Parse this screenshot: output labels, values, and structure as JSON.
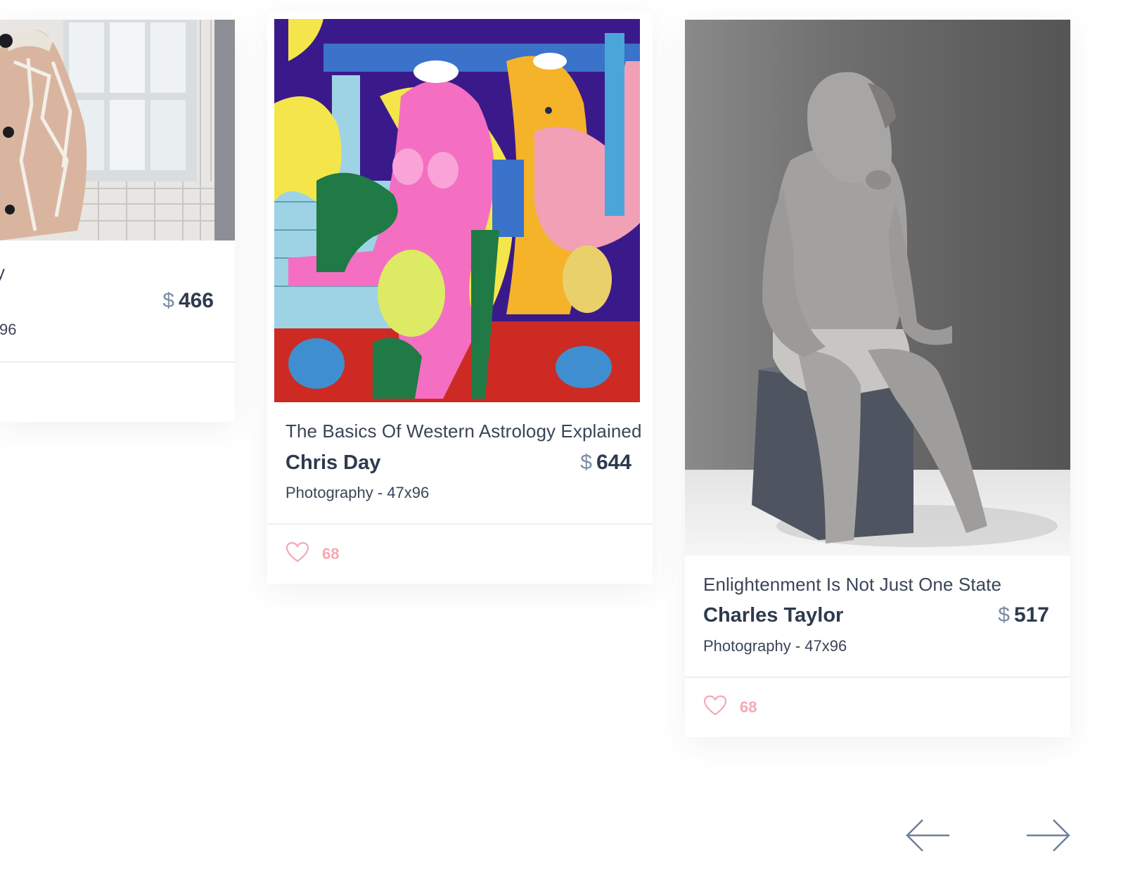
{
  "cards": [
    {
      "title": "y",
      "artist": "",
      "currency": "$",
      "price": "466",
      "meta": "96",
      "likes": ""
    },
    {
      "title": "The Basics Of Western Astrology Explained",
      "artist": "Chris Day",
      "currency": "$",
      "price": "644",
      "meta": "Photography - 47x96",
      "likes": "68"
    },
    {
      "title": "Enlightenment Is Not Just One State",
      "artist": "Charles Taylor",
      "currency": "$",
      "price": "517",
      "meta": "Photography - 47x96",
      "likes": "68"
    }
  ],
  "icons": {
    "like": "heart-icon",
    "prev": "arrow-left-icon",
    "next": "arrow-right-icon"
  },
  "colors": {
    "accent_like": "#f6a8b3",
    "text_dark": "#2e3a4d",
    "currency": "#7b8ba3"
  }
}
